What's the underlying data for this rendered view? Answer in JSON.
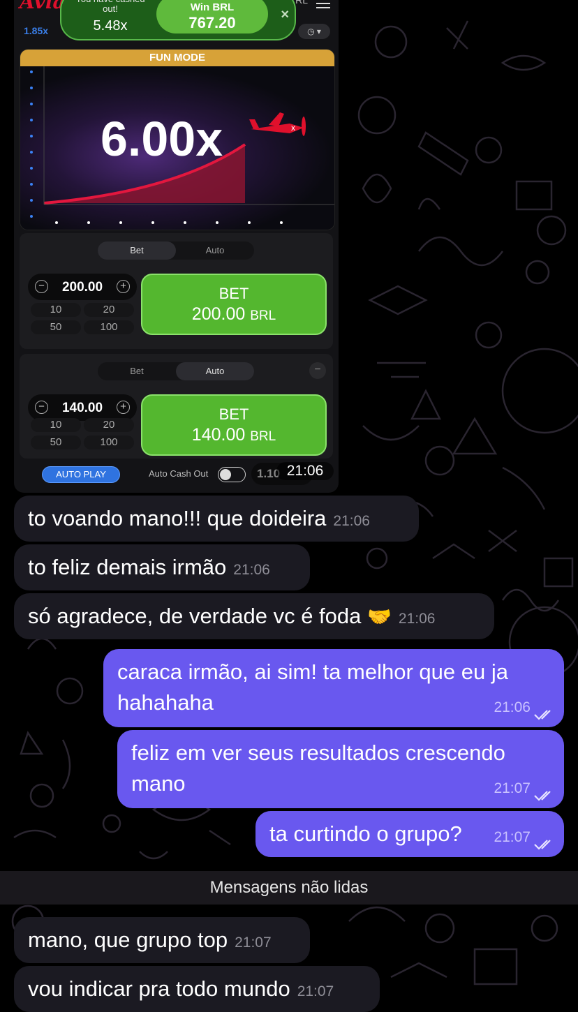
{
  "game": {
    "logo": "Aviator",
    "current_multiplier_small": "1.85x",
    "header_right": "RL",
    "toast": {
      "cashed_out_label": "You have cashed out!",
      "cashed_out_multiplier": "5.48x",
      "win_label": "Win BRL",
      "win_amount": "767.20",
      "close_symbol": "×"
    },
    "fun_mode_label": "FUN MODE",
    "flight_multiplier": "6.00x",
    "bet_panels": [
      {
        "tabs": [
          "Bet",
          "Auto"
        ],
        "active_tab": "Bet",
        "amount": "200.00",
        "quick_amounts": [
          "10",
          "20",
          "50",
          "100"
        ],
        "bet_button_label": "BET",
        "bet_button_amount": "200.00",
        "currency": "BRL"
      },
      {
        "tabs": [
          "Bet",
          "Auto"
        ],
        "active_tab": "Auto",
        "amount": "140.00",
        "quick_amounts": [
          "10",
          "20",
          "50",
          "100"
        ],
        "bet_button_label": "BET",
        "bet_button_amount": "140.00",
        "currency": "BRL"
      }
    ],
    "auto_play_label": "AUTO PLAY",
    "auto_cash_out_label": "Auto Cash Out",
    "auto_cash_out_value": "1.10",
    "screenshot_time": "21:06"
  },
  "messages_before": [
    {
      "direction": "in",
      "text": "to voando mano!!! que doideira",
      "time": "21:06"
    },
    {
      "direction": "in",
      "text": "to feliz demais irmão",
      "time": "21:06"
    },
    {
      "direction": "in",
      "text": "só agradece, de verdade vc é foda",
      "emoji": "🤝",
      "time": "21:06"
    },
    {
      "direction": "out",
      "text": "caraca irmão, ai sim! ta melhor que eu ja hahahaha",
      "time": "21:06",
      "status": "read"
    },
    {
      "direction": "out",
      "text": "feliz em ver seus resultados crescendo mano",
      "time": "21:07",
      "status": "read"
    },
    {
      "direction": "out",
      "text": "ta curtindo o grupo?",
      "time": "21:07",
      "status": "read"
    }
  ],
  "unread_divider": "Mensagens não lidas",
  "messages_after": [
    {
      "direction": "in",
      "text": "mano, que grupo top",
      "time": "21:07"
    },
    {
      "direction": "in",
      "text": "vou indicar pra todo mundo",
      "time": "21:07"
    }
  ],
  "colors": {
    "background": "#000000",
    "incoming_bubble": "#1b1a22",
    "outgoing_bubble": "#6958ef",
    "bet_green": "#54b72f",
    "fun_mode_bar": "#d7a238",
    "auto_play_blue": "#2f73e0"
  }
}
